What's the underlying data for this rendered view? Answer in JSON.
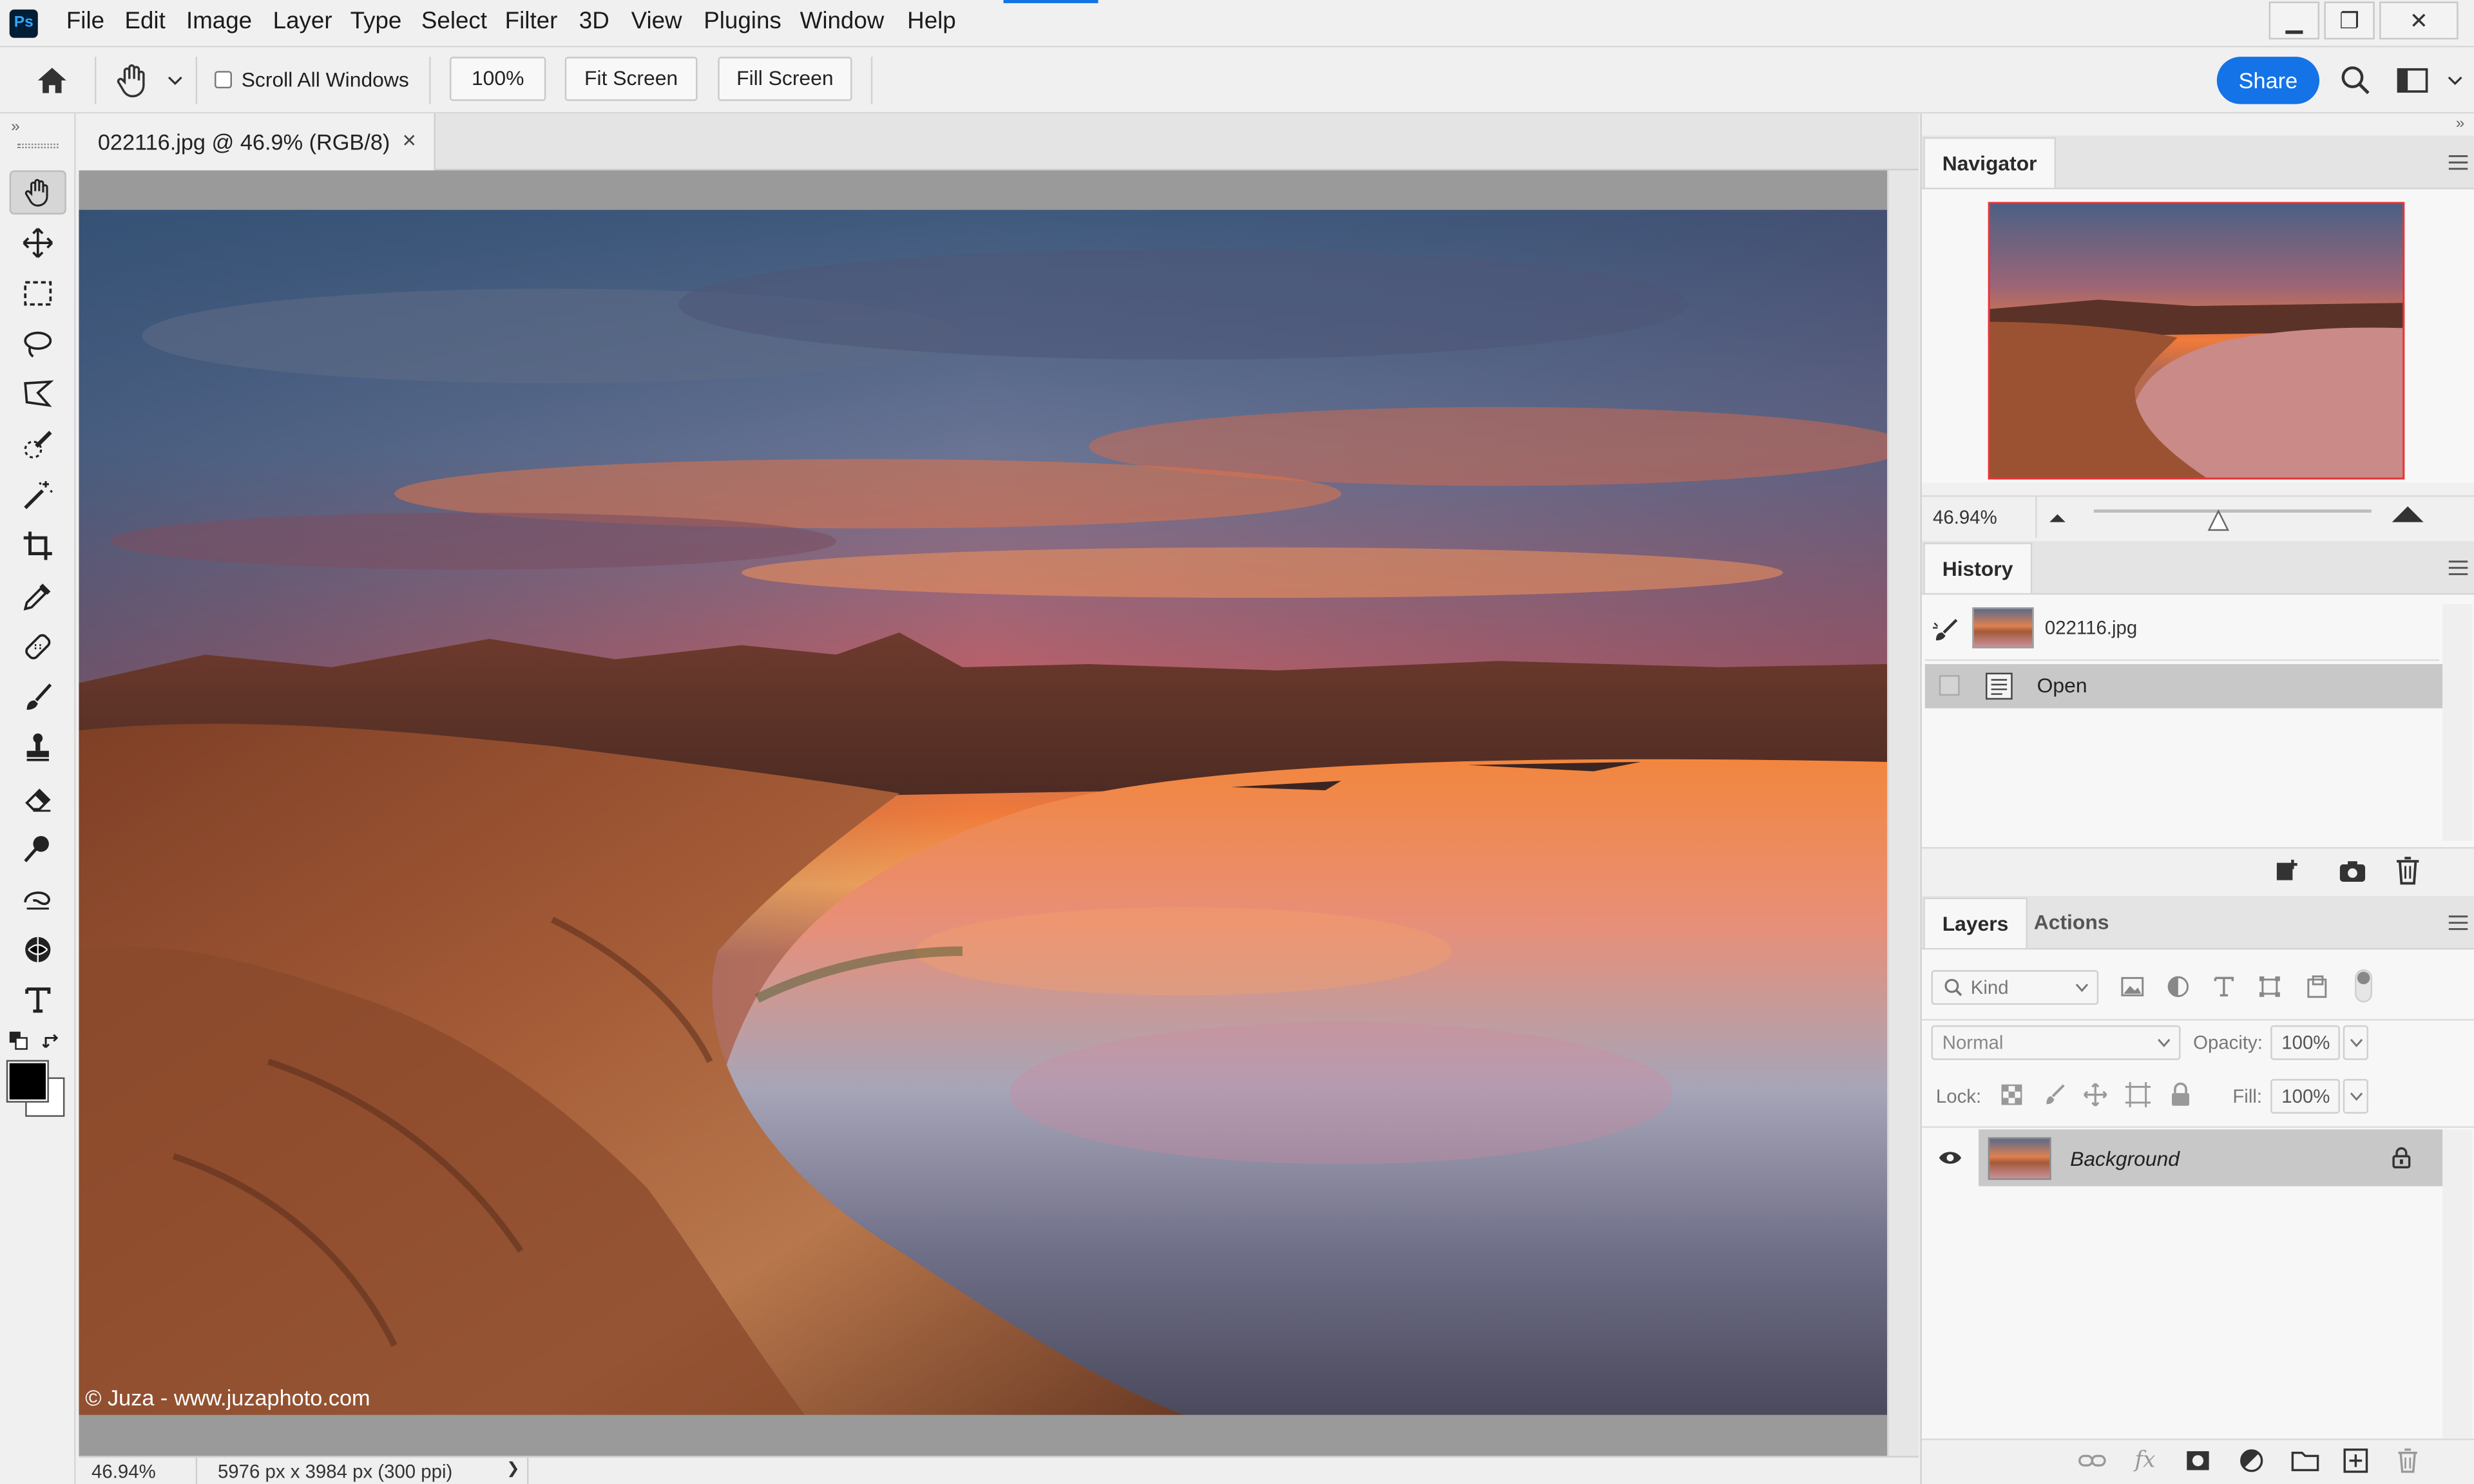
{
  "app": {
    "logo": "Ps"
  },
  "menu": [
    "File",
    "Edit",
    "Image",
    "Layer",
    "Type",
    "Select",
    "Filter",
    "3D",
    "View",
    "Plugins",
    "Window",
    "Help"
  ],
  "window_controls": {
    "minimize": "▁",
    "restore": "❐",
    "close": "✕"
  },
  "options": {
    "scroll_all_windows": "Scroll All Windows",
    "scroll_all_checked": false,
    "zoom_100": "100%",
    "fit_screen": "Fit Screen",
    "fill_screen": "Fill Screen",
    "share": "Share"
  },
  "document": {
    "tab_title": "022116.jpg @ 46.9% (RGB/8)",
    "tab_close": "×",
    "watermark": "© Juza - www.juzaphoto.com"
  },
  "status": {
    "zoom": "46.94%",
    "dimensions": "5976 px x 3984 px (300 ppi)",
    "arrow": "❯"
  },
  "navigator": {
    "title": "Navigator",
    "zoom_value": "46.94%",
    "slider_fraction": 0.45
  },
  "history": {
    "title": "History",
    "snapshot": "022116.jpg",
    "steps": [
      {
        "label": "Open"
      }
    ]
  },
  "layers": {
    "tabs": [
      "Layers",
      "Actions"
    ],
    "kind_filter": "Kind",
    "blend_mode": "Normal",
    "opacity_label": "Opacity:",
    "opacity_value": "100%",
    "lock_label": "Lock:",
    "fill_label": "Fill:",
    "fill_value": "100%",
    "items": [
      {
        "name": "Background",
        "visible": true,
        "locked": true
      }
    ]
  },
  "colors": {
    "accent": "#1473e6",
    "foreground": "#000000",
    "background": "#ffffff",
    "selection": "#c8c8c8"
  }
}
